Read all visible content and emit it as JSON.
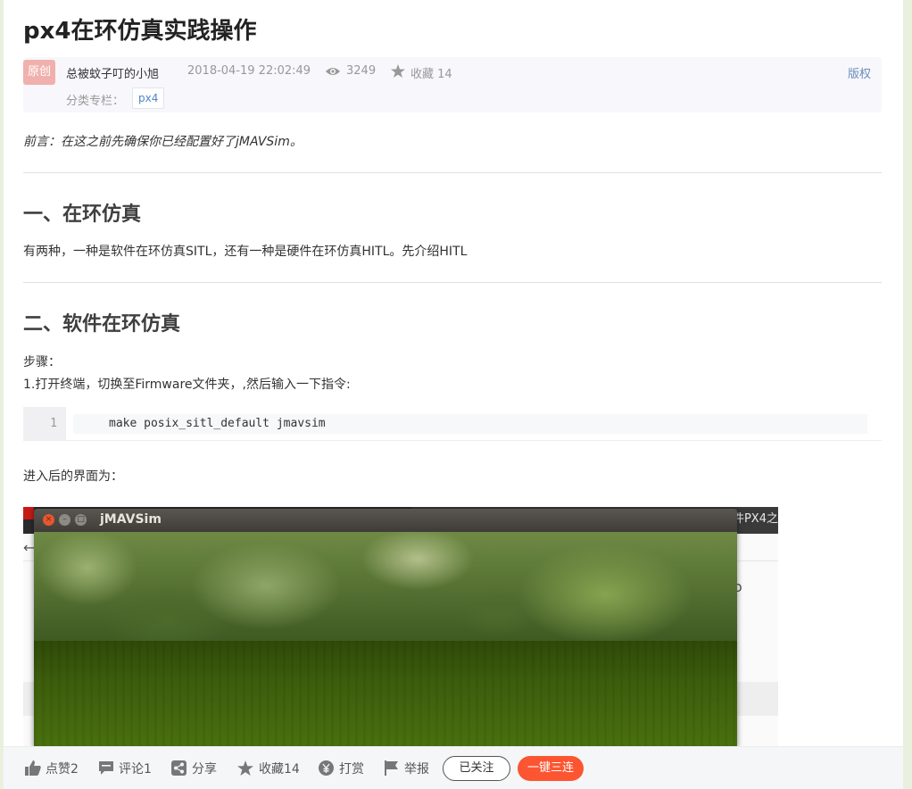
{
  "article": {
    "title": "px4在环仿真实践操作",
    "badge": "原创",
    "author": "总被蚊子叮的小旭",
    "date": "2018-04-19 22:02:49",
    "views": "3249",
    "favorites": "收藏 14",
    "copyright": "版权",
    "category_label": "分类专栏：",
    "category_tag": "px4",
    "preface": "前言：在这之前先确保你已经配置好了jMAVSim。",
    "h2_1": "一、在环仿真",
    "p1": "有两种，一种是软件在环仿真SITL，还有一种是硬件在环仿真HITL。先介绍HITL",
    "h2_2": "二、软件在环仿真",
    "steps_label": "步骤：",
    "step1": "1.打开终端，切换至Firmware文件夹，,然后输入一下指令:",
    "code": {
      "line_no": "1",
      "text": "make posix_sitl_default jmavsim"
    },
    "after_code": "进入后的界面为："
  },
  "screenshot": {
    "window_title": "jMAVSim",
    "bg_text": "件PX4之",
    "bg_back": "←",
    "bg_o": "o"
  },
  "bottom_bar": {
    "like": "点赞2",
    "comment": "评论1",
    "share": "分享",
    "favorite": "收藏14",
    "reward": "打赏",
    "report": "举报",
    "follow": "已关注",
    "triple": "一键三连"
  },
  "colors": {
    "accent": "#fc5531",
    "badge": "#f0b1ac",
    "link": "#4f86c6"
  }
}
